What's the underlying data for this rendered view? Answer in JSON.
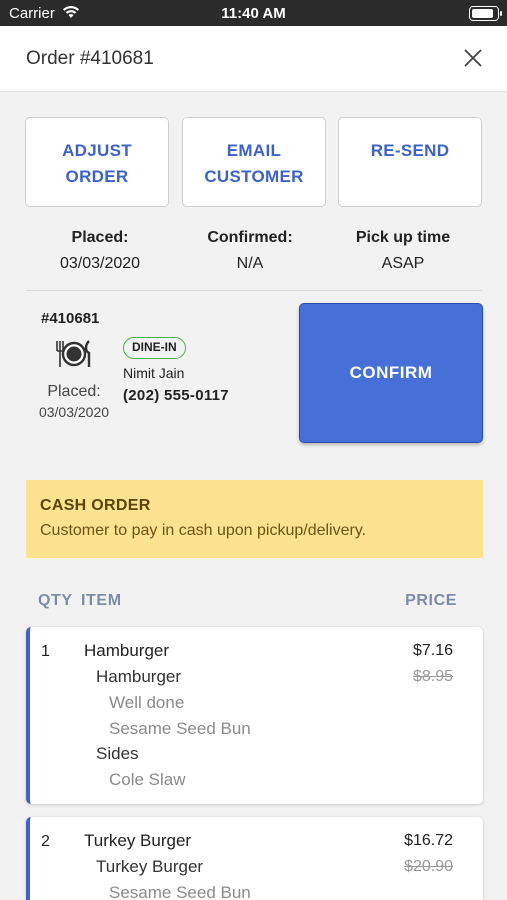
{
  "status_bar": {
    "carrier": "Carrier",
    "time": "11:40 AM"
  },
  "header": {
    "title": "Order #410681"
  },
  "actions": {
    "adjust": [
      "ADJUST",
      "ORDER"
    ],
    "email": [
      "EMAIL",
      "CUSTOMER"
    ],
    "resend": [
      "RE-SEND"
    ]
  },
  "meta": {
    "placed_label": "Placed:",
    "placed_value": "03/03/2020",
    "confirmed_label": "Confirmed:",
    "confirmed_value": "N/A",
    "pickup_label": "Pick up time",
    "pickup_value": "ASAP"
  },
  "order": {
    "number": "#410681",
    "placed_label": "Placed:",
    "placed_date": "03/03/2020",
    "badge": "DINE-IN",
    "customer_name": "Nimit Jain",
    "customer_phone": "(202) 555-0117",
    "confirm_label": "CONFIRM"
  },
  "cash": {
    "title": "CASH ORDER",
    "subtitle": "Customer to pay in cash upon pickup/delivery."
  },
  "table": {
    "qty": "QTY",
    "item": "ITEM",
    "price": "PRICE"
  },
  "items": [
    {
      "qty": "1",
      "name": "Hamburger",
      "price": "$7.16",
      "original_price": "$8.95",
      "lines": [
        "Hamburger",
        "Well done",
        "Sesame Seed Bun",
        "Sides",
        "Cole Slaw"
      ]
    },
    {
      "qty": "2",
      "name": "Turkey Burger",
      "price": "$16.72",
      "original_price": "$20.90",
      "lines": [
        "Turkey Burger",
        "Sesame Seed Bun"
      ]
    }
  ],
  "colors": {
    "accent": "#4670d8",
    "link": "#3d63c9",
    "cash_bg": "#fde28f",
    "badge_border": "#4caf50"
  }
}
